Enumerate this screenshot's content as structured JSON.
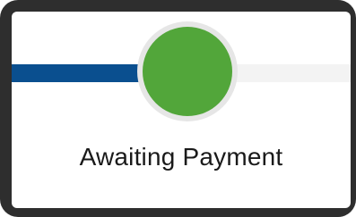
{
  "progress_step": {
    "label": "Awaiting Payment",
    "status": "current"
  },
  "colors": {
    "frame": "#2e2e2e",
    "completed_track": "#0a4f8f",
    "pending_track": "#f3f3f3",
    "active_node": "#52a63a",
    "node_ring": "#e6e6e6"
  }
}
